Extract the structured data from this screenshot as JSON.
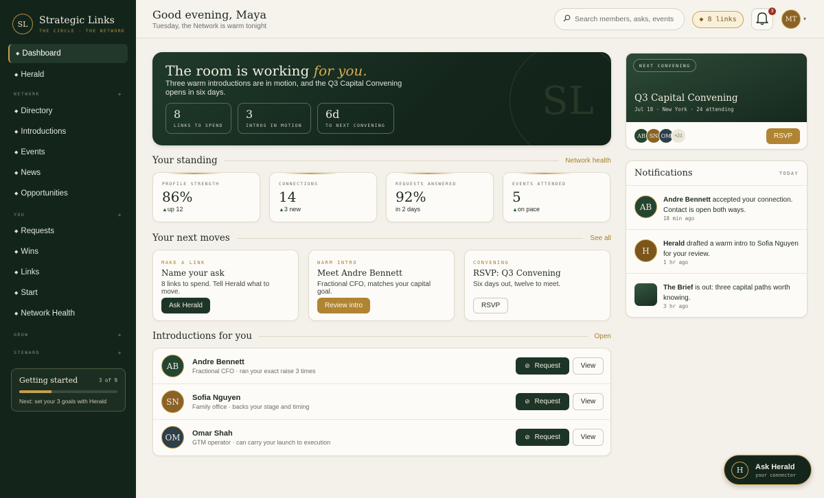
{
  "brand": {
    "initials": "SL",
    "name": "Strategic Links",
    "tagline": "THE CIRCLE · THE NETWORK"
  },
  "sidebar": {
    "items": [
      {
        "label": "Dashboard",
        "active": true
      },
      {
        "label": "Herald"
      },
      {
        "label": "Directory"
      },
      {
        "label": "Introductions"
      },
      {
        "label": "Events"
      },
      {
        "label": "News"
      },
      {
        "label": "Opportunities"
      },
      {
        "label": "Requests"
      },
      {
        "label": "Wins"
      },
      {
        "label": "Links"
      },
      {
        "label": "Start"
      },
      {
        "label": "Network Health"
      }
    ],
    "sections": [
      "NETWORK",
      "YOU",
      "GROW",
      "STEWARD"
    ],
    "getting_started": {
      "title": "Getting started",
      "count": "3 of 9",
      "progress": 0.33,
      "next": "Next: set your 3 goals with Herald"
    }
  },
  "topbar": {
    "greeting": "Good evening, Maya",
    "subtitle": "Tuesday, the Network is warm tonight",
    "search_placeholder": "Search members, asks, events",
    "links_pill": "◆ 8 links",
    "notif_count": "3",
    "user_initials": "MT"
  },
  "hero": {
    "title_main": "The room is working",
    "title_accent": "for you.",
    "body": "Three warm introductions are in motion, and the Q3 Capital Convening opens in six days.",
    "watermark": "SL",
    "stats": [
      {
        "value": "8",
        "label": "LINKS TO SPEND"
      },
      {
        "value": "3",
        "label": "INTROS IN MOTION"
      },
      {
        "value": "6d",
        "label": "TO NEXT CONVENING"
      }
    ]
  },
  "standing": {
    "title": "Your standing",
    "link": "Network health",
    "cards": [
      {
        "label": "PROFILE STRENGTH",
        "value": "86%",
        "delta": "up 12",
        "up": true
      },
      {
        "label": "CONNECTIONS",
        "value": "14",
        "delta": "3 new",
        "up": true
      },
      {
        "label": "REQUESTS ANSWERED",
        "value": "92%",
        "delta": "in 2 days",
        "up": false
      },
      {
        "label": "EVENTS ATTENDED",
        "value": "5",
        "delta": "on pace",
        "up": true
      }
    ]
  },
  "moves": {
    "title": "Your next moves",
    "link": "See all",
    "cards": [
      {
        "kicker": "MAKE A LINK",
        "title": "Name your ask",
        "desc": "8 links to spend. Tell Herald what to move.",
        "button": "Ask Herald"
      },
      {
        "kicker": "WARM INTRO",
        "title": "Meet Andre Bennett",
        "desc": "Fractional CFO, matches your capital goal.",
        "button": "Review intro"
      },
      {
        "kicker": "CONVENING",
        "title": "RSVP: Q3 Convening",
        "desc": "Six days out, twelve to meet.",
        "button": "RSVP"
      }
    ]
  },
  "intros": {
    "title": "Introductions for you",
    "link": "Open",
    "request_label": "Request",
    "view_label": "View",
    "rows": [
      {
        "initials": "AB",
        "name": "Andre Bennett",
        "desc": "Fractional CFO · ran your exact raise 3 times",
        "color": "#244531"
      },
      {
        "initials": "SN",
        "name": "Sofia Nguyen",
        "desc": "Family office · backs your stage and timing",
        "color": "#8b6225"
      },
      {
        "initials": "OM",
        "name": "Omar Shah",
        "desc": "GTM operator · can carry your launch to execution",
        "color": "#2c3f4b"
      }
    ]
  },
  "convening": {
    "tag": "NEXT CONVENING",
    "title": "Q3 Capital Convening",
    "meta": "Jul 18 · New York · 24 attending",
    "attendees": [
      "AB",
      "SN",
      "OM"
    ],
    "more": "+21",
    "rsvp": "RSVP"
  },
  "notifications": {
    "title": "Notifications",
    "filter": "TODAY",
    "items": [
      {
        "initials": "AB",
        "actor": "Andre Bennett",
        "text": " accepted your connection. Contact is open both ways.",
        "time": "18 min ago"
      },
      {
        "initials": "H",
        "actor": "Herald",
        "text": " drafted a warm intro to Sofia Nguyen for your review.",
        "time": "1 hr ago"
      },
      {
        "initials": "",
        "actor": "The Brief",
        "text": " is out: three capital paths worth knowing.",
        "time": "3 hr ago"
      }
    ]
  },
  "fab": {
    "initial": "H",
    "title": "Ask Herald",
    "subtitle": "your connector"
  }
}
